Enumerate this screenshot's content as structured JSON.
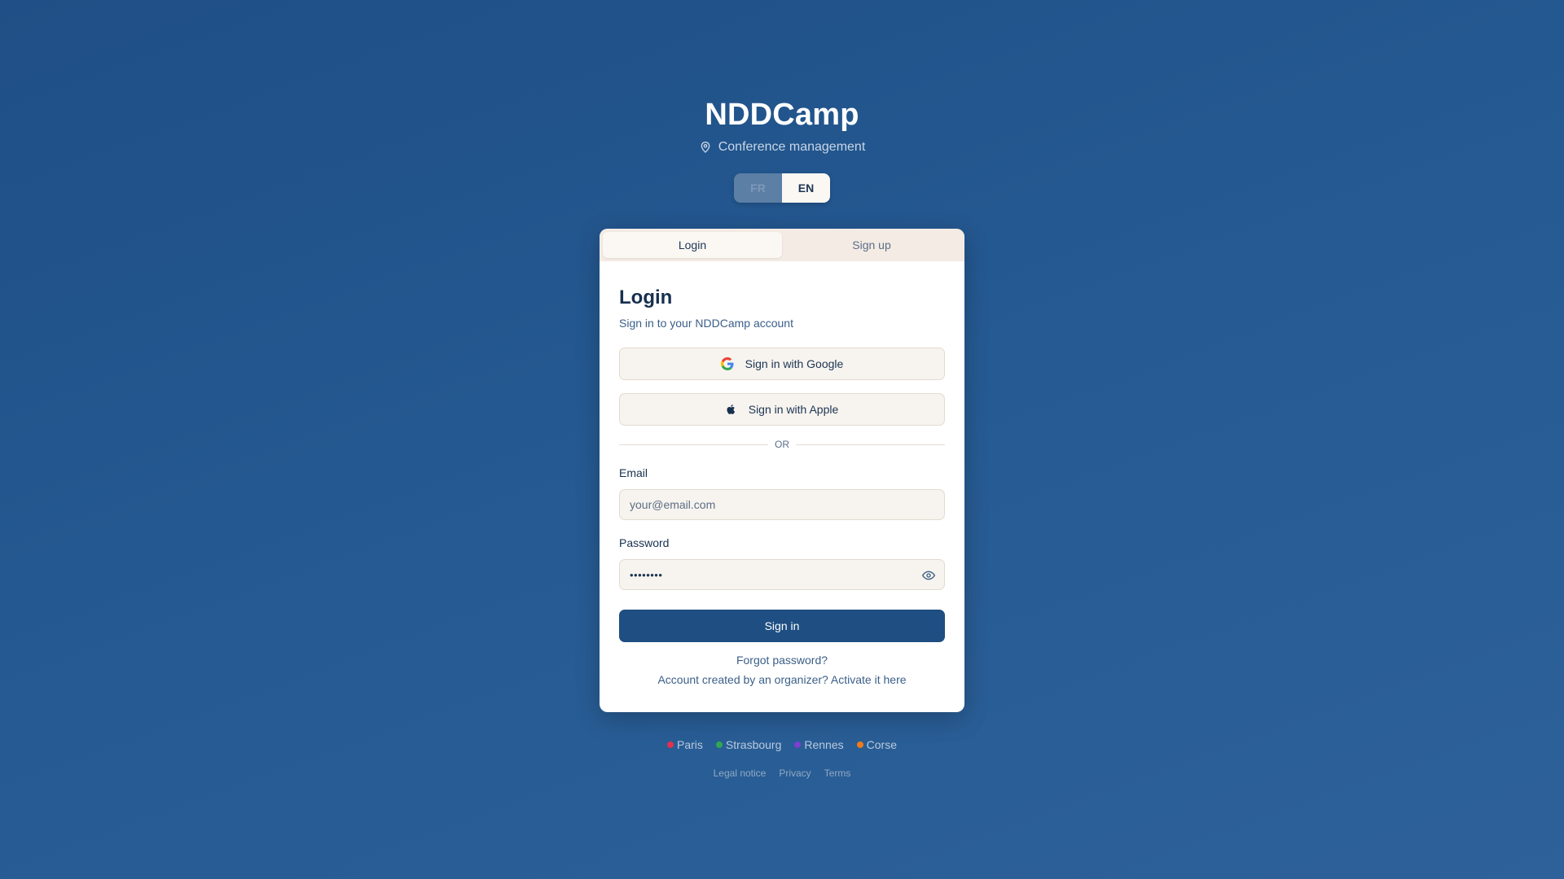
{
  "app": {
    "title": "NDDCamp",
    "subtitle": "Conference management",
    "subtitle_icon": "map-pin-icon"
  },
  "language": {
    "options": [
      "FR",
      "EN"
    ],
    "selected": "EN"
  },
  "tabs": [
    {
      "label": "Login",
      "active": true
    },
    {
      "label": "Sign up",
      "active": false
    }
  ],
  "login": {
    "heading": "Login",
    "description": "Sign in to your NDDCamp account",
    "google_label": "Sign in with Google",
    "apple_label": "Sign in with Apple",
    "divider": "OR",
    "email_label": "Email",
    "email_placeholder": "your@email.com",
    "email_value": "",
    "password_label": "Password",
    "password_value": "••••••••",
    "submit_label": "Sign in",
    "forgot_label": "Forgot password?",
    "activate_label": "Account created by an organizer? Activate it here"
  },
  "regions": [
    {
      "name": "Paris",
      "color": "#e0314f"
    },
    {
      "name": "Strasbourg",
      "color": "#2fa84f"
    },
    {
      "name": "Rennes",
      "color": "#7b3fd1"
    },
    {
      "name": "Corse",
      "color": "#f07a1a"
    }
  ],
  "footer": {
    "links": [
      "Legal notice",
      "Privacy",
      "Terms"
    ]
  },
  "colors": {
    "accent": "#1e4e82",
    "background": "#255a92"
  }
}
